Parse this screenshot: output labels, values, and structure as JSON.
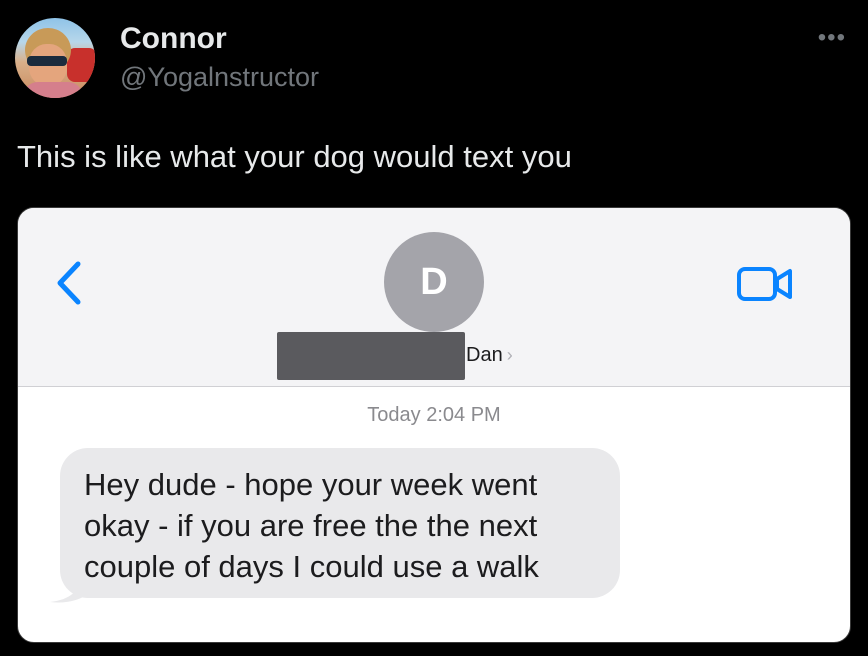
{
  "tweet": {
    "author_name": "Connor",
    "author_handle": "@Yogalnstructor",
    "text": "This is like what your dog would text you",
    "more_icon": "more-horizontal-icon"
  },
  "screenshot": {
    "contact_initial": "D",
    "contact_name": "Dan",
    "timestamp": "Today 2:04 PM",
    "message_lines": [
      "Hey dude - hope your week went",
      "okay - if you are free the the next",
      "couple of days I could use a walk"
    ],
    "accent_color": "#0a84ff",
    "icons": [
      "back-chevron-icon",
      "video-camera-icon",
      "chevron-right-icon"
    ]
  }
}
